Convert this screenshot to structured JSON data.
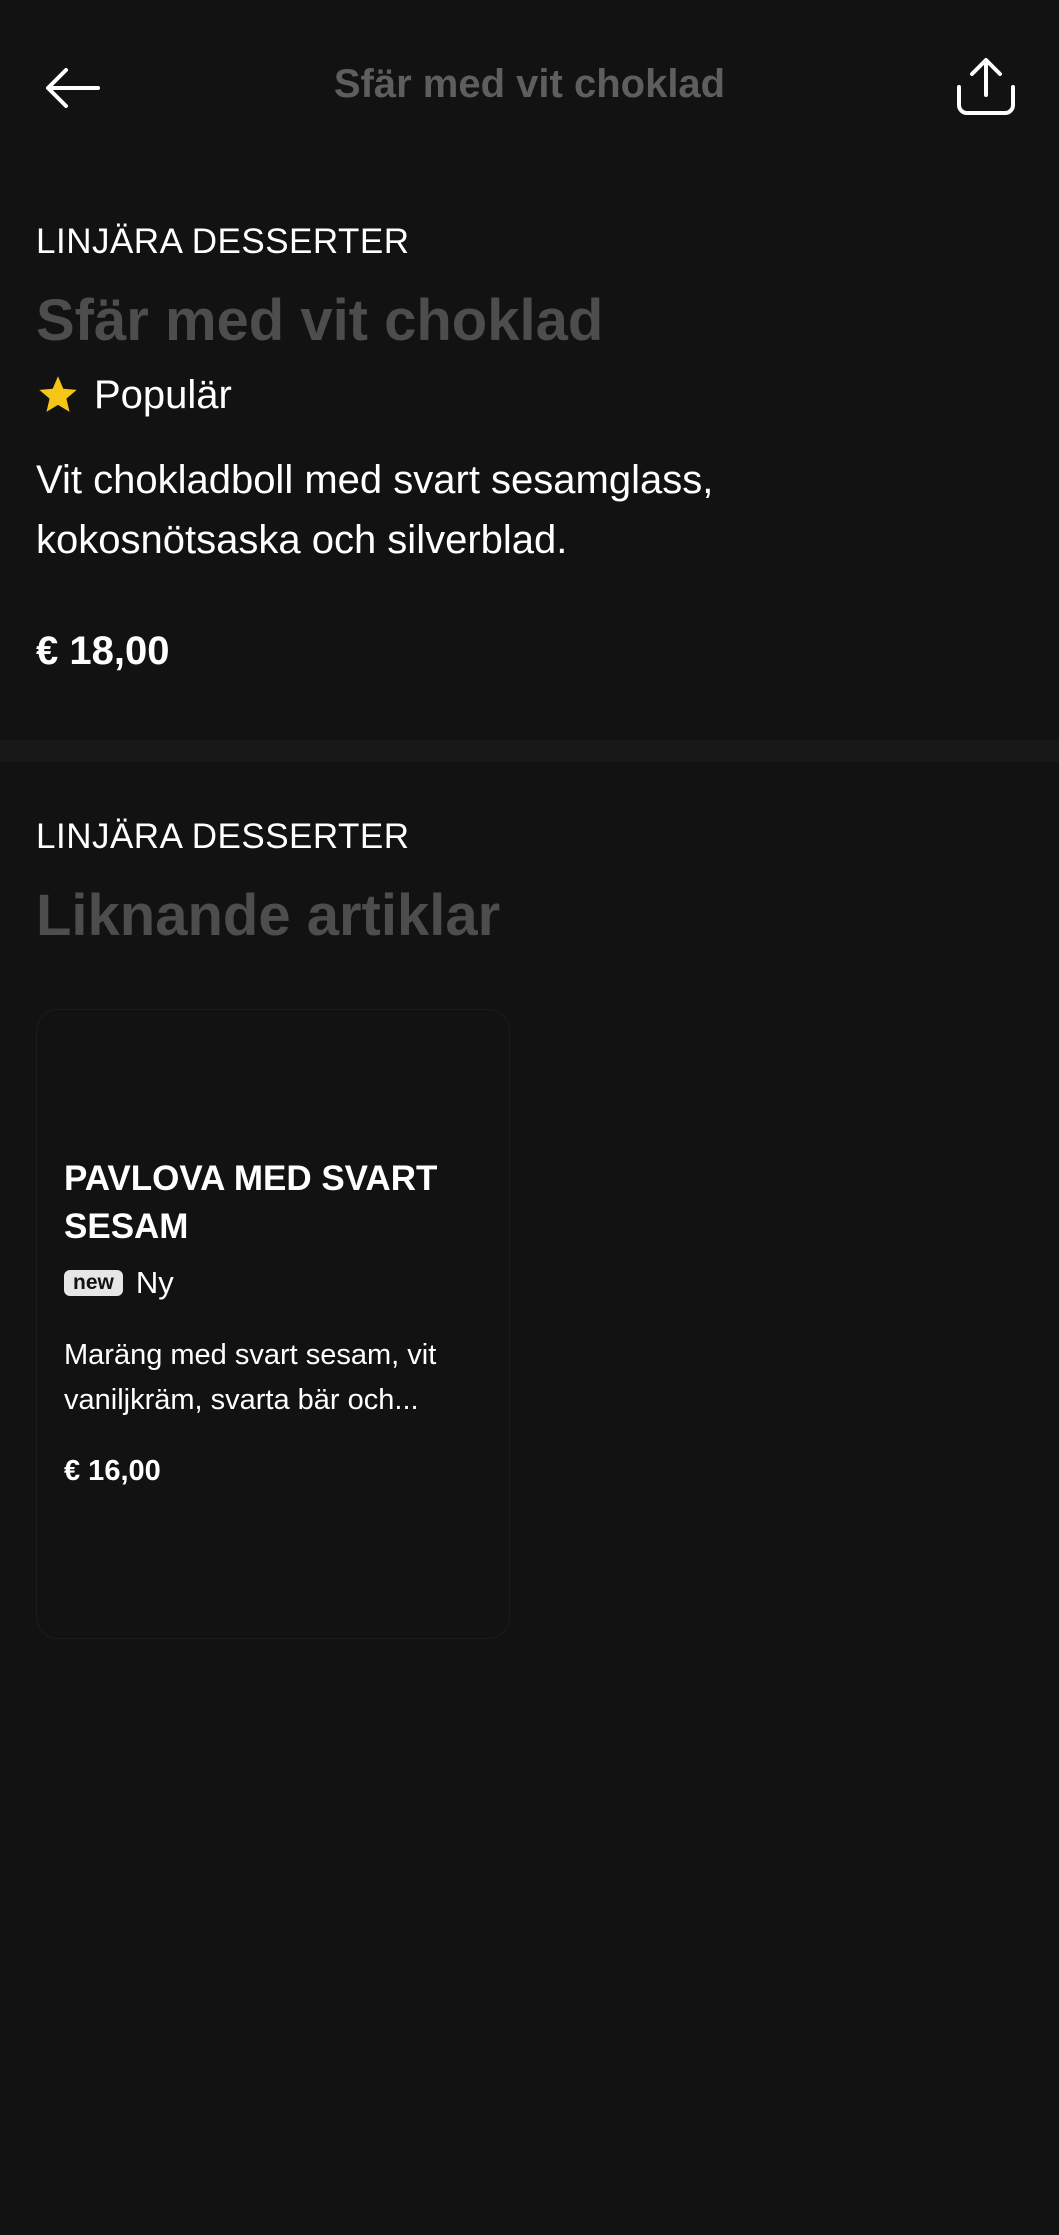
{
  "header": {
    "title": "Sfär med vit choklad",
    "back_icon": "arrow-left-icon",
    "share_icon": "share-icon"
  },
  "product": {
    "category": "LINJÄRA DESSERTER",
    "title": "Sfär med vit choklad",
    "badge_icon": "star-icon",
    "badge_label": "Populär",
    "description": "Vit chokladboll med svart sesamglass, kokosnötsaska och silverblad.",
    "price": "€ 18,00"
  },
  "related": {
    "category": "LINJÄRA DESSERTER",
    "title": "Liknande artiklar",
    "items": [
      {
        "title": "PAVLOVA MED SVART SESAM",
        "tag": "new",
        "badge_label": "Ny",
        "description": "Maräng med svart sesam, vit vaniljkräm, svarta bär och...",
        "price": "€ 16,00"
      }
    ]
  },
  "colors": {
    "background": "#121212",
    "text": "#ffffff",
    "muted_title": "#4d4d4d",
    "star": "#f5c518"
  }
}
